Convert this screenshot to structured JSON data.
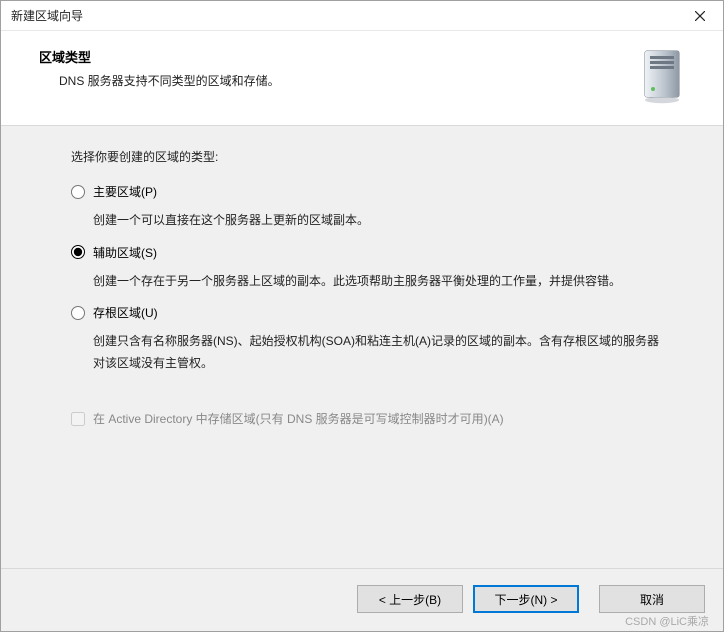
{
  "window": {
    "title": "新建区域向导"
  },
  "header": {
    "title": "区域类型",
    "subtitle": "DNS 服务器支持不同类型的区域和存储。"
  },
  "content": {
    "prompt": "选择你要创建的区域的类型:",
    "options": [
      {
        "label": "主要区域(P)",
        "desc": "创建一个可以直接在这个服务器上更新的区域副本。"
      },
      {
        "label": "辅助区域(S)",
        "desc": "创建一个存在于另一个服务器上区域的副本。此选项帮助主服务器平衡处理的工作量，并提供容错。"
      },
      {
        "label": "存根区域(U)",
        "desc": "创建只含有名称服务器(NS)、起始授权机构(SOA)和粘连主机(A)记录的区域的副本。含有存根区域的服务器对该区域没有主管权。"
      }
    ],
    "selected": 1,
    "checkbox": {
      "label": "在 Active Directory 中存储区域(只有 DNS 服务器是可写域控制器时才可用)(A)",
      "enabled": false,
      "checked": false
    }
  },
  "footer": {
    "back": "< 上一步(B)",
    "next": "下一步(N) >",
    "cancel": "取消"
  },
  "watermark": "CSDN @LiC乘凉"
}
